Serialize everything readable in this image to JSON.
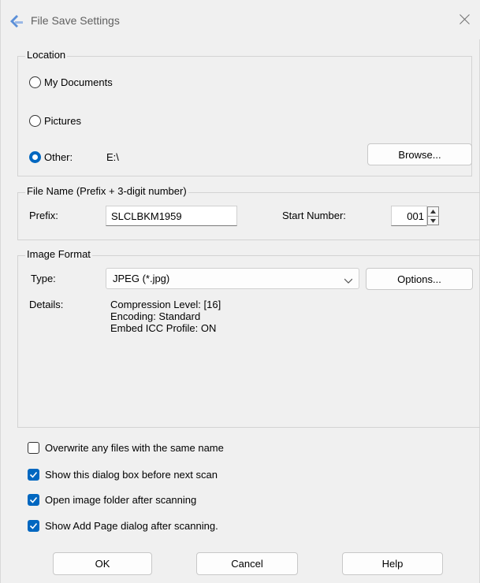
{
  "window": {
    "title": "File Save Settings"
  },
  "location": {
    "group_title": "Location",
    "options": [
      {
        "label": "My Documents",
        "checked": false
      },
      {
        "label": "Pictures",
        "checked": false
      },
      {
        "label": "Other:",
        "checked": true
      }
    ],
    "other_path": "E:\\",
    "browse_label": "Browse..."
  },
  "file_name": {
    "group_title": "File Name (Prefix + 3-digit number)",
    "prefix_label": "Prefix:",
    "prefix_value": "SLCLBKM1959",
    "start_label": "Start Number:",
    "start_value": "001"
  },
  "image_format": {
    "group_title": "Image Format",
    "type_label": "Type:",
    "type_value": "JPEG (*.jpg)",
    "options_label": "Options...",
    "details_label": "Details:",
    "details_lines": [
      "Compression Level: [16]",
      "Encoding: Standard",
      "Embed ICC Profile: ON"
    ]
  },
  "checkboxes": [
    {
      "label": "Overwrite any files with the same name",
      "checked": false
    },
    {
      "label": "Show this dialog box before next scan",
      "checked": true
    },
    {
      "label": "Open image folder after scanning",
      "checked": true
    },
    {
      "label": "Show Add Page dialog after scanning.",
      "checked": true
    }
  ],
  "buttons": {
    "ok": "OK",
    "cancel": "Cancel",
    "help": "Help"
  },
  "colors": {
    "accent": "#0067c0",
    "background": "#f0f0f0"
  }
}
